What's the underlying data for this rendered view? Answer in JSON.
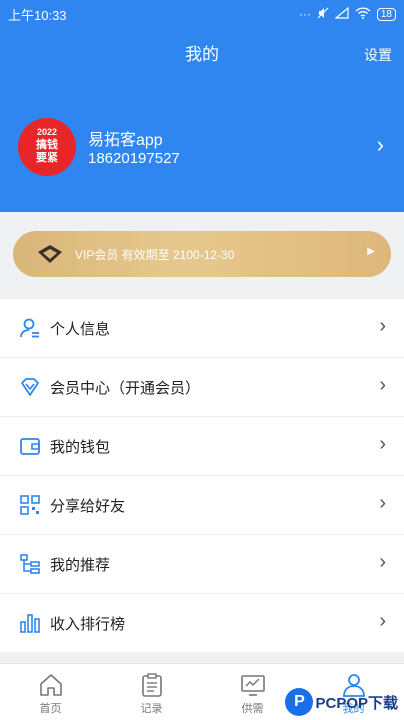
{
  "status_bar": {
    "time": "上午10:33",
    "battery": "18"
  },
  "header": {
    "title": "我的",
    "settings_label": "设置"
  },
  "profile": {
    "avatar_text_1": "2022",
    "avatar_text_2": "搞钱",
    "avatar_text_3": "要紧",
    "name": "易拓客app",
    "phone": "18620197527"
  },
  "vip": {
    "text": "VIP会员 有效期至 2100-12-30",
    "arrow": "▶"
  },
  "menu": {
    "items": [
      {
        "label": "个人信息",
        "icon": "user-icon"
      },
      {
        "label": "会员中心（开通会员）",
        "icon": "diamond-icon"
      },
      {
        "label": "我的钱包",
        "icon": "wallet-icon"
      },
      {
        "label": "分享给好友",
        "icon": "qrcode-icon"
      },
      {
        "label": "我的推荐",
        "icon": "tree-icon"
      },
      {
        "label": "收入排行榜",
        "icon": "bar-chart-icon"
      }
    ]
  },
  "tabbar": {
    "tabs": [
      {
        "label": "首页",
        "icon": "home-icon"
      },
      {
        "label": "记录",
        "icon": "clipboard-icon"
      },
      {
        "label": "供需",
        "icon": "monitor-icon"
      },
      {
        "label": "我的",
        "icon": "profile-icon",
        "active": true
      }
    ]
  },
  "watermark": {
    "logo_letter": "P",
    "text": "PCPOP下载"
  },
  "colors": {
    "primary": "#2f86f0",
    "vip_gold": "#dfbd80",
    "avatar_red": "#e8262a"
  }
}
